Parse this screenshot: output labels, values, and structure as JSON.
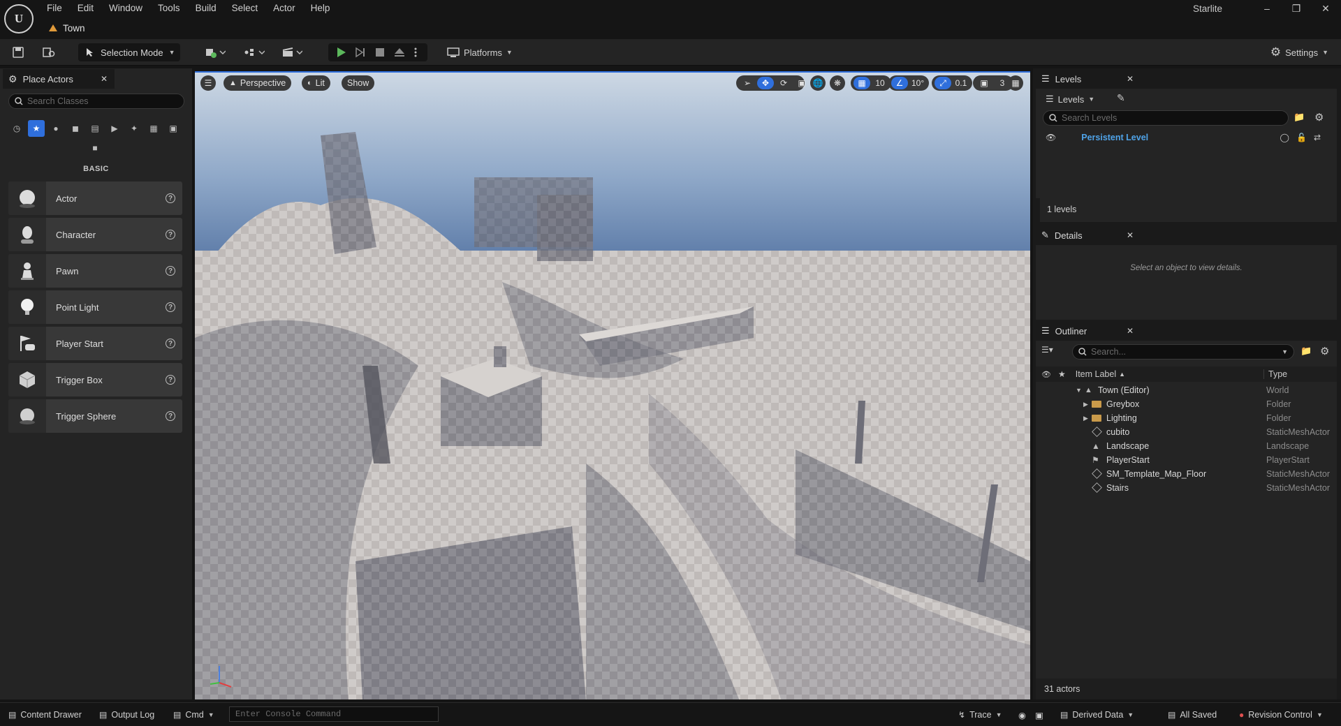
{
  "menu": [
    "File",
    "Edit",
    "Window",
    "Tools",
    "Build",
    "Select",
    "Actor",
    "Help"
  ],
  "document_tab": "Town",
  "app_name": "Starlite",
  "toolbar": {
    "selection_mode": "Selection Mode",
    "platforms": "Platforms",
    "settings": "Settings"
  },
  "place_actors": {
    "tab_title": "Place Actors",
    "search_placeholder": "Search Classes",
    "section_label": "BASIC",
    "items": [
      "Actor",
      "Character",
      "Pawn",
      "Point Light",
      "Player Start",
      "Trigger Box",
      "Trigger Sphere"
    ]
  },
  "viewport": {
    "perspective": "Perspective",
    "lit": "Lit",
    "show": "Show",
    "grid_snap": "10",
    "rotation_snap": "10°",
    "scale_snap": "0.1",
    "camera_speed": "3"
  },
  "levels": {
    "tab_title": "Levels",
    "dropdown": "Levels",
    "search_placeholder": "Search Levels",
    "persistent_level": "Persistent Level",
    "count": "1 levels"
  },
  "details": {
    "tab_title": "Details",
    "empty_message": "Select an object to view details."
  },
  "outliner": {
    "tab_title": "Outliner",
    "search_placeholder": "Search...",
    "col_label": "Item Label",
    "col_type": "Type",
    "rows": [
      {
        "label": "Town (Editor)",
        "type": "World"
      },
      {
        "label": "Greybox",
        "type": "Folder"
      },
      {
        "label": "Lighting",
        "type": "Folder"
      },
      {
        "label": "cubito",
        "type": "StaticMeshActor"
      },
      {
        "label": "Landscape",
        "type": "Landscape"
      },
      {
        "label": "PlayerStart",
        "type": "PlayerStart"
      },
      {
        "label": "SM_Template_Map_Floor",
        "type": "StaticMeshActor"
      },
      {
        "label": "Stairs",
        "type": "StaticMeshActor"
      }
    ],
    "actor_count": "31 actors"
  },
  "statusbar": {
    "content_drawer": "Content Drawer",
    "output_log": "Output Log",
    "cmd": "Cmd",
    "console_placeholder": "Enter Console Command",
    "trace": "Trace",
    "derived_data": "Derived Data",
    "all_saved": "All Saved",
    "revision_control": "Revision Control"
  },
  "colors": {
    "accent": "#2f6fdc",
    "play_green": "#5cb85c",
    "folder": "#c99a4a",
    "persistent_level": "#4fa3e8"
  }
}
